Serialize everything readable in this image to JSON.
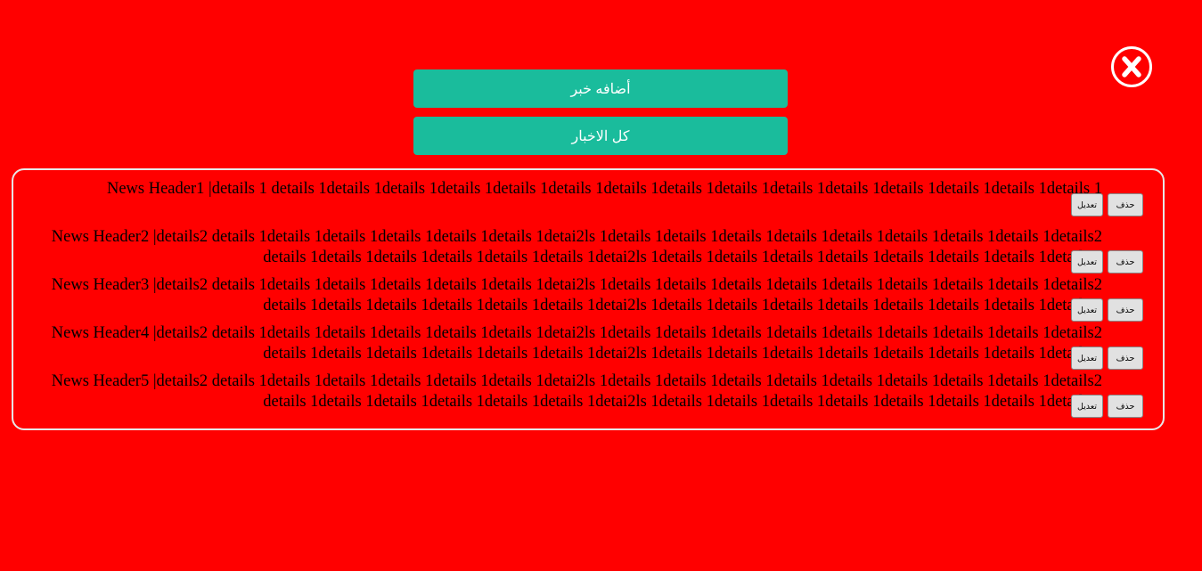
{
  "buttons": {
    "add_news": "أضافه خبر",
    "all_news": "كل الاخبار"
  },
  "colors": {
    "background": "#ff0000",
    "accent": "#1abc9c"
  },
  "close_icon": "close-circle-icon",
  "news": [
    {
      "text": "News Header1 |details 1 details 1details 1details 1details 1details 1details 1details 1details 1details 1details 1details 1details 1details 1details 1details 1",
      "edit_label": "تعديل",
      "delete_label": "حذف"
    },
    {
      "text": "News Header2 |details2 details 1details 1details 1details 1details 1details 1detai2ls 1details 1details 1details 1details 1details 1details 1details 1details 1details2 details 1details 1details 1details 1details 1details 1detai2ls 1details 1details 1details 1details 1details 1details 1details 1details 1",
      "edit_label": "تعديل",
      "delete_label": "حذف"
    },
    {
      "text": "News Header3 |details2 details 1details 1details 1details 1details 1details 1detai2ls 1details 1details 1details 1details 1details 1details 1details 1details 1details2 details 1details 1details 1details 1details 1details 1detai2ls 1details 1details 1details 1details 1details 1details 1details 1details 1",
      "edit_label": "تعديل",
      "delete_label": "حذف"
    },
    {
      "text": "News Header4 |details2 details 1details 1details 1details 1details 1details 1detai2ls 1details 1details 1details 1details 1details 1details 1details 1details 1details2 details 1details 1details 1details 1details 1details 1detai2ls 1details 1details 1details 1details 1details 1details 1details 1details 1",
      "edit_label": "تعديل",
      "delete_label": "حذف"
    },
    {
      "text": "News Header5 |details2 details 1details 1details 1details 1details 1details 1detai2ls 1details 1details 1details 1details 1details 1details 1details 1details 1details2 details 1details 1details 1details 1details 1details 1detai2ls 1details 1details 1details 1details 1details 1details 1details 1details 1",
      "edit_label": "تعديل",
      "delete_label": "حذف"
    }
  ]
}
